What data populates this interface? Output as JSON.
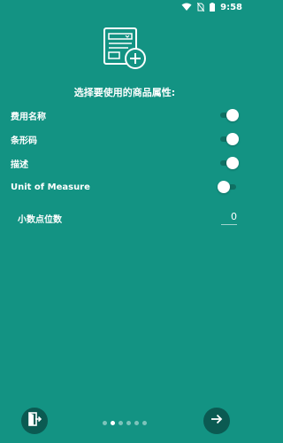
{
  "status_bar": {
    "time": "9:58"
  },
  "heading": "选择要使用的商品属性:",
  "attributes": [
    {
      "label": "费用名称",
      "enabled": true
    },
    {
      "label": "条形码",
      "enabled": true
    },
    {
      "label": "描述",
      "enabled": true
    },
    {
      "label": "Unit of Measure",
      "enabled": false
    }
  ],
  "decimal": {
    "label": "小数点位数",
    "value": "0"
  },
  "pagination": {
    "total": 6,
    "current": 2
  },
  "colors": {
    "background": "#139383",
    "button": "#0b5a52"
  },
  "icons": {
    "hero": "add-document-icon",
    "exit": "exit-door-icon",
    "next": "arrow-right-icon"
  }
}
